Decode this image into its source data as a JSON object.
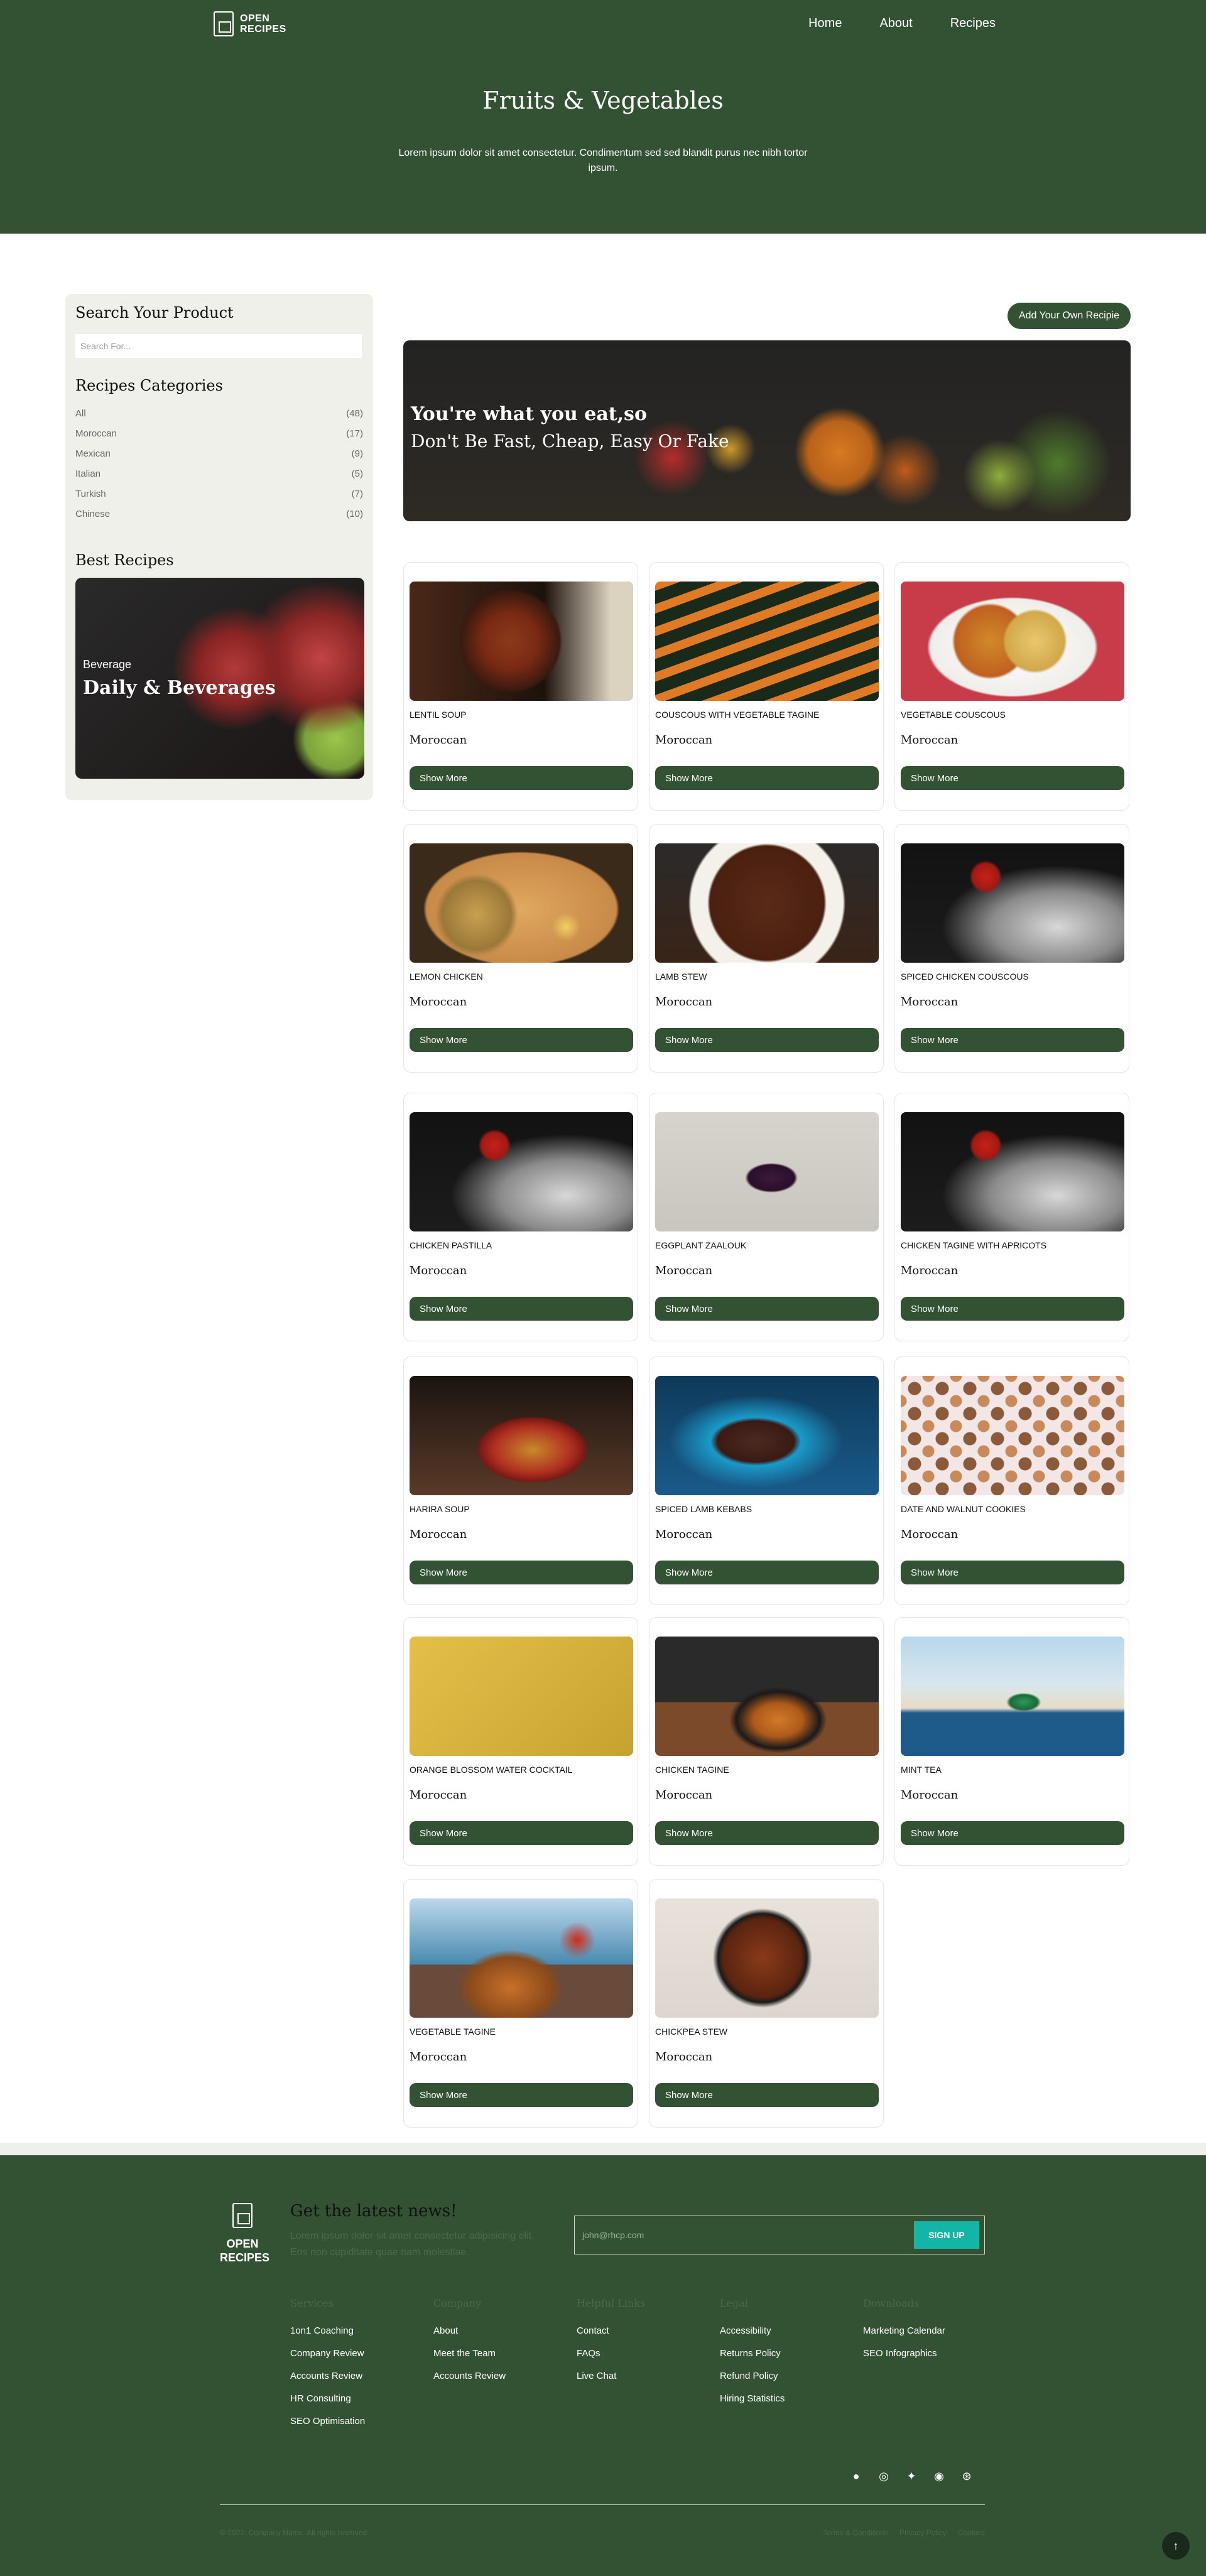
{
  "header": {
    "logo_line1": "OPEN",
    "logo_line2": "RECIPES",
    "nav": [
      "Home",
      "About",
      "Recipes"
    ],
    "title": "Fruits & Vegetables",
    "subtitle": "Lorem ipsum dolor sit amet consectetur. Condimentum sed sed blandit purus nec nibh tortor ipsum."
  },
  "sidebar": {
    "search_heading": "Search Your Product",
    "search_placeholder": "Search For...",
    "categories_heading": "Recipes Categories",
    "categories": [
      {
        "name": "All",
        "count": "(48)"
      },
      {
        "name": "Moroccan",
        "count": "(17)"
      },
      {
        "name": "Mexican",
        "count": "(9)"
      },
      {
        "name": "Italian",
        "count": "(5)"
      },
      {
        "name": "Turkish",
        "count": "(7)"
      },
      {
        "name": "Chinese",
        "count": "(10)"
      }
    ],
    "best_heading": "Best Recipes",
    "best_tag": "Beverage",
    "best_title": "Daily & Beverages"
  },
  "main": {
    "add_button": "Add Your Own Recipie",
    "banner_line1": "You're what you eat,so",
    "banner_line2": "Don't Be Fast, Cheap, Easy Or Fake",
    "button_label": "Show More",
    "recipes": [
      {
        "title": "LENTIL SOUP",
        "category": "Moroccan",
        "img": "lentil-soup"
      },
      {
        "title": "COUSCOUS WITH VEGETABLE TAGINE",
        "category": "Moroccan",
        "img": "carrots"
      },
      {
        "title": "VEGETABLE COUSCOUS",
        "category": "Moroccan",
        "img": "couscous"
      },
      {
        "title": "LEMON CHICKEN",
        "category": "Moroccan",
        "img": "lemon-chicken"
      },
      {
        "title": "LAMB STEW",
        "category": "Moroccan",
        "img": "lamb-stew"
      },
      {
        "title": "SPICED CHICKEN COUSCOUS",
        "category": "Moroccan",
        "img": "chicken"
      },
      {
        "title": "CHICKEN PASTILLA",
        "category": "Moroccan",
        "img": "chicken"
      },
      {
        "title": "EGGPLANT ZAALOUK",
        "category": "Moroccan",
        "img": "eggplant"
      },
      {
        "title": "CHICKEN TAGINE WITH APRICOTS",
        "category": "Moroccan",
        "img": "chicken"
      },
      {
        "title": "HARIRA SOUP",
        "category": "Moroccan",
        "img": "harira"
      },
      {
        "title": "SPICED LAMB KEBABS",
        "category": "Moroccan",
        "img": "kebabs"
      },
      {
        "title": "DATE AND WALNUT COOKIES",
        "category": "Moroccan",
        "img": "cookies"
      },
      {
        "title": "ORANGE BLOSSOM WATER COCKTAIL",
        "category": "Moroccan",
        "img": "cocktail"
      },
      {
        "title": "CHICKEN TAGINE",
        "category": "Moroccan",
        "img": "tagine"
      },
      {
        "title": "MINT TEA",
        "category": "Moroccan",
        "img": "mint-tea"
      },
      {
        "title": "VEGETABLE TAGINE",
        "category": "Moroccan",
        "img": "veg-tagine"
      },
      {
        "title": "CHICKPEA STEW",
        "category": "Moroccan",
        "img": "chickpea"
      }
    ]
  },
  "footer": {
    "logo_line1": "OPEN",
    "logo_line2": "RECIPES",
    "news_heading": "Get the latest news!",
    "news_sub": "Lorem ipsum dolor sit amet consectetur adipisicing elit. Eos non cupiditate quae nam molestiae.",
    "email_placeholder": "john@rhcp.com",
    "signup": "SIGN UP",
    "columns": [
      {
        "heading": "Services",
        "links": [
          "1on1 Coaching",
          "Company Review",
          "Accounts Review",
          "HR Consulting",
          "SEO Optimisation"
        ]
      },
      {
        "heading": "Company",
        "links": [
          "About",
          "Meet the Team",
          "Accounts Review"
        ]
      },
      {
        "heading": "Helpful Links",
        "links": [
          "Contact",
          "FAQs",
          "Live Chat"
        ]
      },
      {
        "heading": "Legal",
        "links": [
          "Accessibility",
          "Returns Policy",
          "Refund Policy",
          "Hiring Statistics"
        ]
      },
      {
        "heading": "Downloads",
        "links": [
          "Marketing Calendar",
          "SEO Infographics"
        ]
      }
    ],
    "social_icons": [
      "facebook-icon",
      "instagram-icon",
      "twitter-icon",
      "github-icon",
      "dribbble-icon"
    ],
    "copyright": "© 2022. Company Name. All rights reserved.",
    "legal_links": [
      "Terms & Conditions",
      "Privacy Policy",
      "Cookies"
    ]
  }
}
